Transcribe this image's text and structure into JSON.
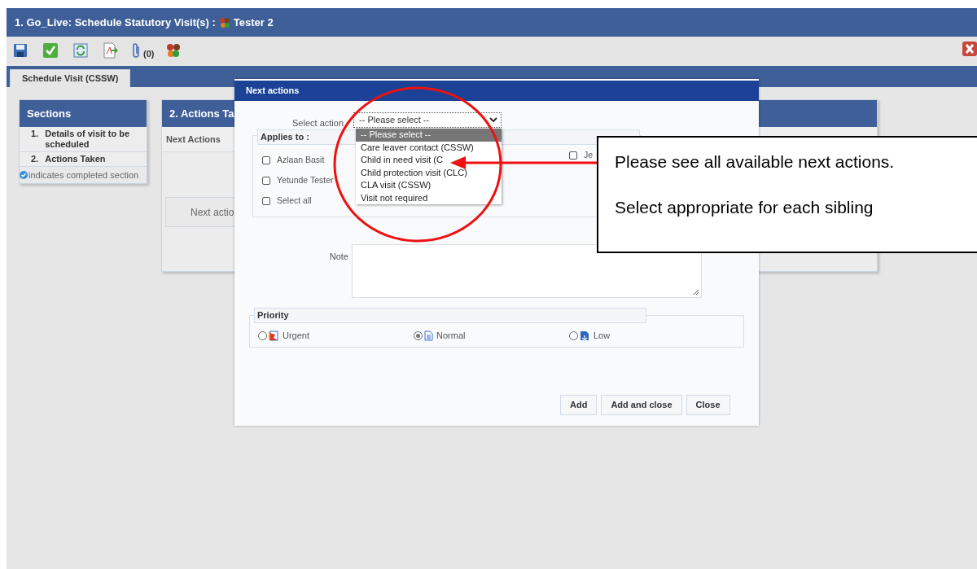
{
  "window": {
    "title": "1. Go_Live: Schedule Statutory Visit(s) :",
    "subject": "Tester 2"
  },
  "toolbar": {
    "attachments_count": "(0)"
  },
  "tabs": [
    {
      "label": "Schedule Visit (CSSW)",
      "selected": true
    }
  ],
  "sections_panel": {
    "title": "Sections",
    "items": [
      {
        "number": "1.",
        "label": "Details of visit to be scheduled"
      },
      {
        "number": "2.",
        "label": "Actions Taken"
      }
    ],
    "legend": "indicates completed section"
  },
  "actions_panel": {
    "title": "2. Actions Ta",
    "subheader": "Next Actions",
    "empty_box": "Next actio"
  },
  "dialog": {
    "title": "Next actions",
    "select_label": "Select action",
    "select_value": "-- Please select --",
    "dropdown_options": [
      {
        "label": "-- Please select --",
        "selected": true
      },
      {
        "label": "Care leaver contact (CSSW)",
        "selected": false
      },
      {
        "label": "Child in need visit (C",
        "selected": false
      },
      {
        "label": "Child protection visit (CLC)",
        "selected": false
      },
      {
        "label": "CLA visit (CSSW)",
        "selected": false
      },
      {
        "label": "Visit not required",
        "selected": false
      }
    ],
    "applies_to": {
      "title": "Applies to :",
      "left": [
        {
          "label": "Azlaan Basit",
          "checked": false
        },
        {
          "label": "Yetunde Tester",
          "checked": false
        },
        {
          "label": "Select all",
          "checked": false
        }
      ],
      "right": [
        {
          "label": "Je",
          "checked": false
        }
      ]
    },
    "note_label": "Note",
    "priority": {
      "title": "Priority",
      "options": [
        {
          "kind": "urgent",
          "label": "Urgent",
          "selected": false
        },
        {
          "kind": "normal",
          "label": "Normal",
          "selected": true
        },
        {
          "kind": "low",
          "label": "Low",
          "selected": false
        }
      ]
    },
    "buttons": [
      "Add",
      "Add and close",
      "Close"
    ]
  },
  "callout": {
    "lines": [
      "Please see all available next actions.",
      "Select appropriate for each sibling"
    ]
  }
}
